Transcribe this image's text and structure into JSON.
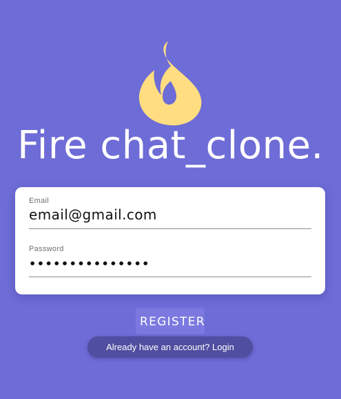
{
  "brand": {
    "title": "Fire chat_clone.",
    "icon": "flame-icon",
    "icon_color": "#ffdd80",
    "background_color": "#6e6cd6"
  },
  "form": {
    "email": {
      "label": "Email",
      "value": "email@gmail.com"
    },
    "password": {
      "label": "Password",
      "value": "•••••••••••••••"
    }
  },
  "actions": {
    "register_label": "REGISTER",
    "login_link_label": "Already have an account? Login"
  }
}
